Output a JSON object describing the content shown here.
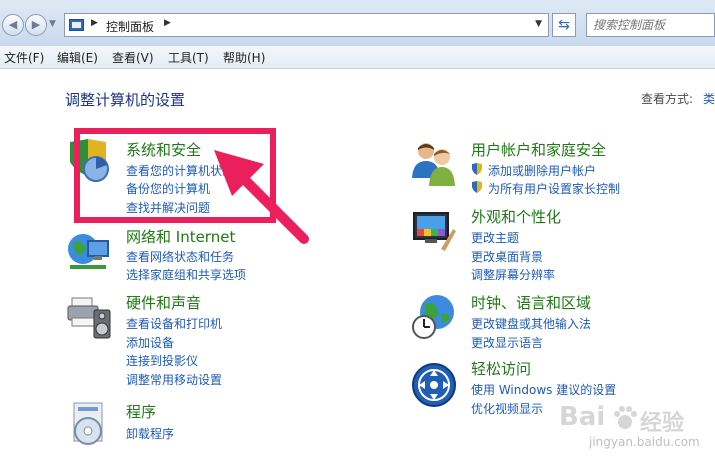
{
  "window": {
    "address": {
      "breadcrumb": "控制面板"
    },
    "search": {
      "placeholder": "搜索控制面板"
    }
  },
  "menubar": {
    "items": [
      {
        "label": "文件(F)"
      },
      {
        "label": "编辑(E)"
      },
      {
        "label": "查看(V)"
      },
      {
        "label": "工具(T)"
      },
      {
        "label": "帮助(H)"
      }
    ]
  },
  "main": {
    "title": "调整计算机的设置",
    "view_by": {
      "label": "查看方式:",
      "value": "类"
    }
  },
  "categories": [
    {
      "title": "系统和安全",
      "icon": "system-security-icon",
      "links": [
        "查看您的计算机状态",
        "备份您的计算机",
        "查找并解决问题"
      ]
    },
    {
      "title": "网络和 Internet",
      "icon": "network-icon",
      "links": [
        "查看网络状态和任务",
        "选择家庭组和共享选项"
      ]
    },
    {
      "title": "硬件和声音",
      "icon": "hardware-sound-icon",
      "links": [
        "查看设备和打印机",
        "添加设备",
        "连接到投影仪",
        "调整常用移动设置"
      ]
    },
    {
      "title": "程序",
      "icon": "programs-icon",
      "links": [
        "卸载程序"
      ]
    },
    {
      "title": "用户帐户和家庭安全",
      "icon": "user-accounts-icon",
      "links": [
        "添加或删除用户帐户",
        "为所有用户设置家长控制"
      ]
    },
    {
      "title": "外观和个性化",
      "icon": "appearance-icon",
      "links": [
        "更改主题",
        "更改桌面背景",
        "调整屏幕分辨率"
      ]
    },
    {
      "title": "时钟、语言和区域",
      "icon": "clock-language-icon",
      "links": [
        "更改键盘或其他输入法",
        "更改显示语言"
      ]
    },
    {
      "title": "轻松访问",
      "icon": "ease-of-access-icon",
      "links": [
        "使用 Windows 建议的设置",
        "优化视频显示"
      ]
    }
  ],
  "annotation": {
    "color": "#ea1f5b"
  },
  "watermark": {
    "brand": "Bai",
    "brand2": "经验",
    "url": "jingyan.baidu.com"
  },
  "colors": {
    "category_title": "#1e7a14",
    "link": "#1e5bb8",
    "page_title": "#1e3287"
  }
}
